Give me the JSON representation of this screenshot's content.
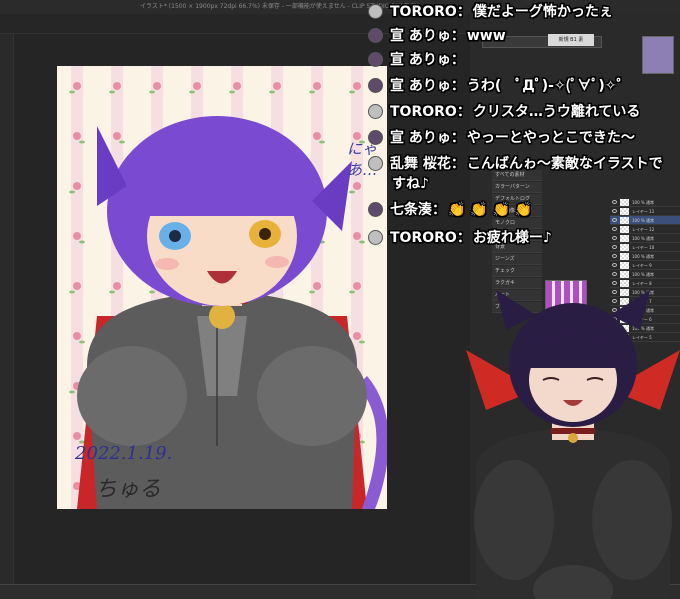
{
  "app": {
    "title": "イラスト* (1500 × 1900px 72dpi 66.7%)  未保存 - 一部機能が使えません - CLIP STUDIO PAINT EX"
  },
  "artwork": {
    "caption": "にゃあ…"
  },
  "panels": {
    "material_header": "新規 B1 素",
    "tools": [
      "すべての素材",
      "カラーパターン",
      "デフォルトログ",
      "素材画像",
      "モノクロ",
      "カラー",
      "背景",
      "ジーンズ",
      "チェック",
      "ラクガキ",
      "ハート",
      "ブラシ"
    ],
    "layers": [
      {
        "label": "100 % 通常",
        "selected": false
      },
      {
        "label": "レイヤー 11",
        "selected": false
      },
      {
        "label": "100 % 通常",
        "selected": true
      },
      {
        "label": "レイヤー 12",
        "selected": false
      },
      {
        "label": "100 % 通常",
        "selected": false
      },
      {
        "label": "レイヤー 10",
        "selected": false
      },
      {
        "label": "100 % 通常",
        "selected": false
      },
      {
        "label": "レイヤー 9",
        "selected": false
      },
      {
        "label": "100 % 通常",
        "selected": false
      },
      {
        "label": "レイヤー 8",
        "selected": false
      },
      {
        "label": "100 % 通常",
        "selected": false
      },
      {
        "label": "レイヤー 7",
        "selected": false
      },
      {
        "label": "100 % 通常",
        "selected": false
      },
      {
        "label": "レイヤー 6",
        "selected": false
      },
      {
        "label": "100 % 通常",
        "selected": false
      },
      {
        "label": "レイヤー 5",
        "selected": false
      }
    ]
  },
  "chat": [
    {
      "name": "TORORO：",
      "text": "僕だよーグ怖かったぇ",
      "avatar": "light"
    },
    {
      "name": "宣 ありゅ：",
      "text": "www",
      "avatar": "dark"
    },
    {
      "name": "宣 ありゅ：",
      "text": "",
      "avatar": "dark"
    },
    {
      "name": "宣 ありゅ：",
      "text": "うわ(　ﾟДﾟ)-✧(ﾟ∀ﾟ)✧゜",
      "avatar": "dark"
    },
    {
      "name": "TORORO：",
      "text": "クリスタ…うウ離れている",
      "avatar": "light"
    },
    {
      "name": "宣 ありゅ：",
      "text": "やっーとやっとこできた〜",
      "avatar": "dark"
    },
    {
      "name": "乱舞 桜花：",
      "text": "こんばんゎ〜素敵なイラストで",
      "avatar": "light"
    },
    {
      "name": "",
      "text": "すね♪",
      "avatar": "none"
    },
    {
      "name": "七条湊：",
      "text": "👏 👏 👏 👏",
      "avatar": "dark"
    },
    {
      "name": "TORORO：",
      "text": "お疲れ様ー♪",
      "avatar": "light"
    }
  ]
}
